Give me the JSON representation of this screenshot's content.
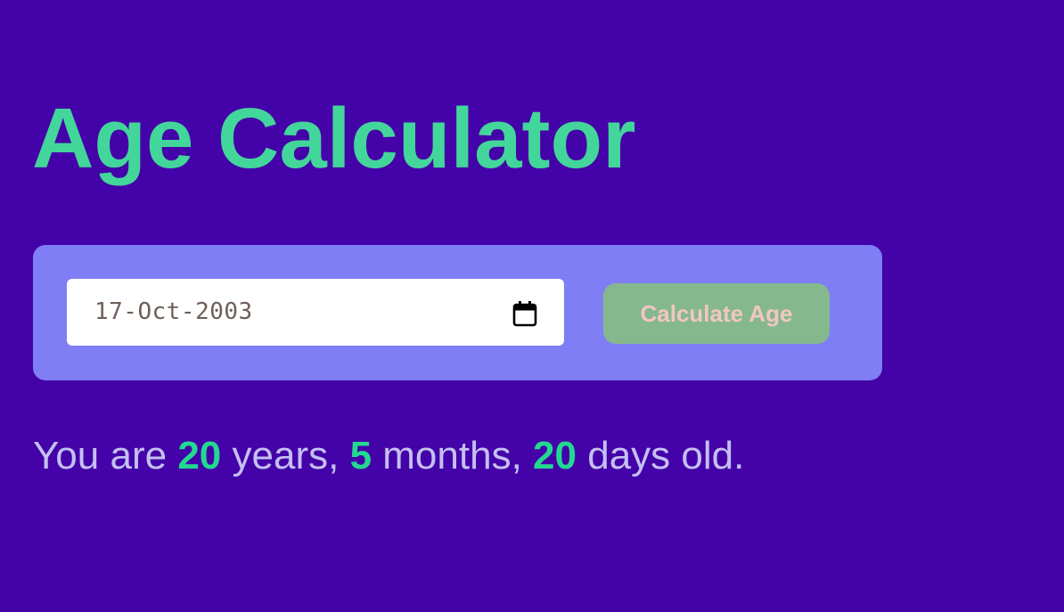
{
  "page": {
    "title": "Age Calculator"
  },
  "form": {
    "date_value": "17-Oct-2003",
    "button_label": "Calculate Age"
  },
  "result": {
    "prefix": "You are",
    "years": "20",
    "years_label": "years,",
    "months": "5",
    "months_label": "months,",
    "days": "20",
    "days_label": "days old."
  },
  "colors": {
    "background": "#4403a8",
    "title": "#43d69b",
    "panel": "#7f7ef4",
    "button": "#86b88e",
    "button_text": "#f2c7c0",
    "result_text": "#c4c0f2",
    "result_number": "#22d990"
  },
  "icons": {
    "date_picker": "calendar-icon"
  }
}
